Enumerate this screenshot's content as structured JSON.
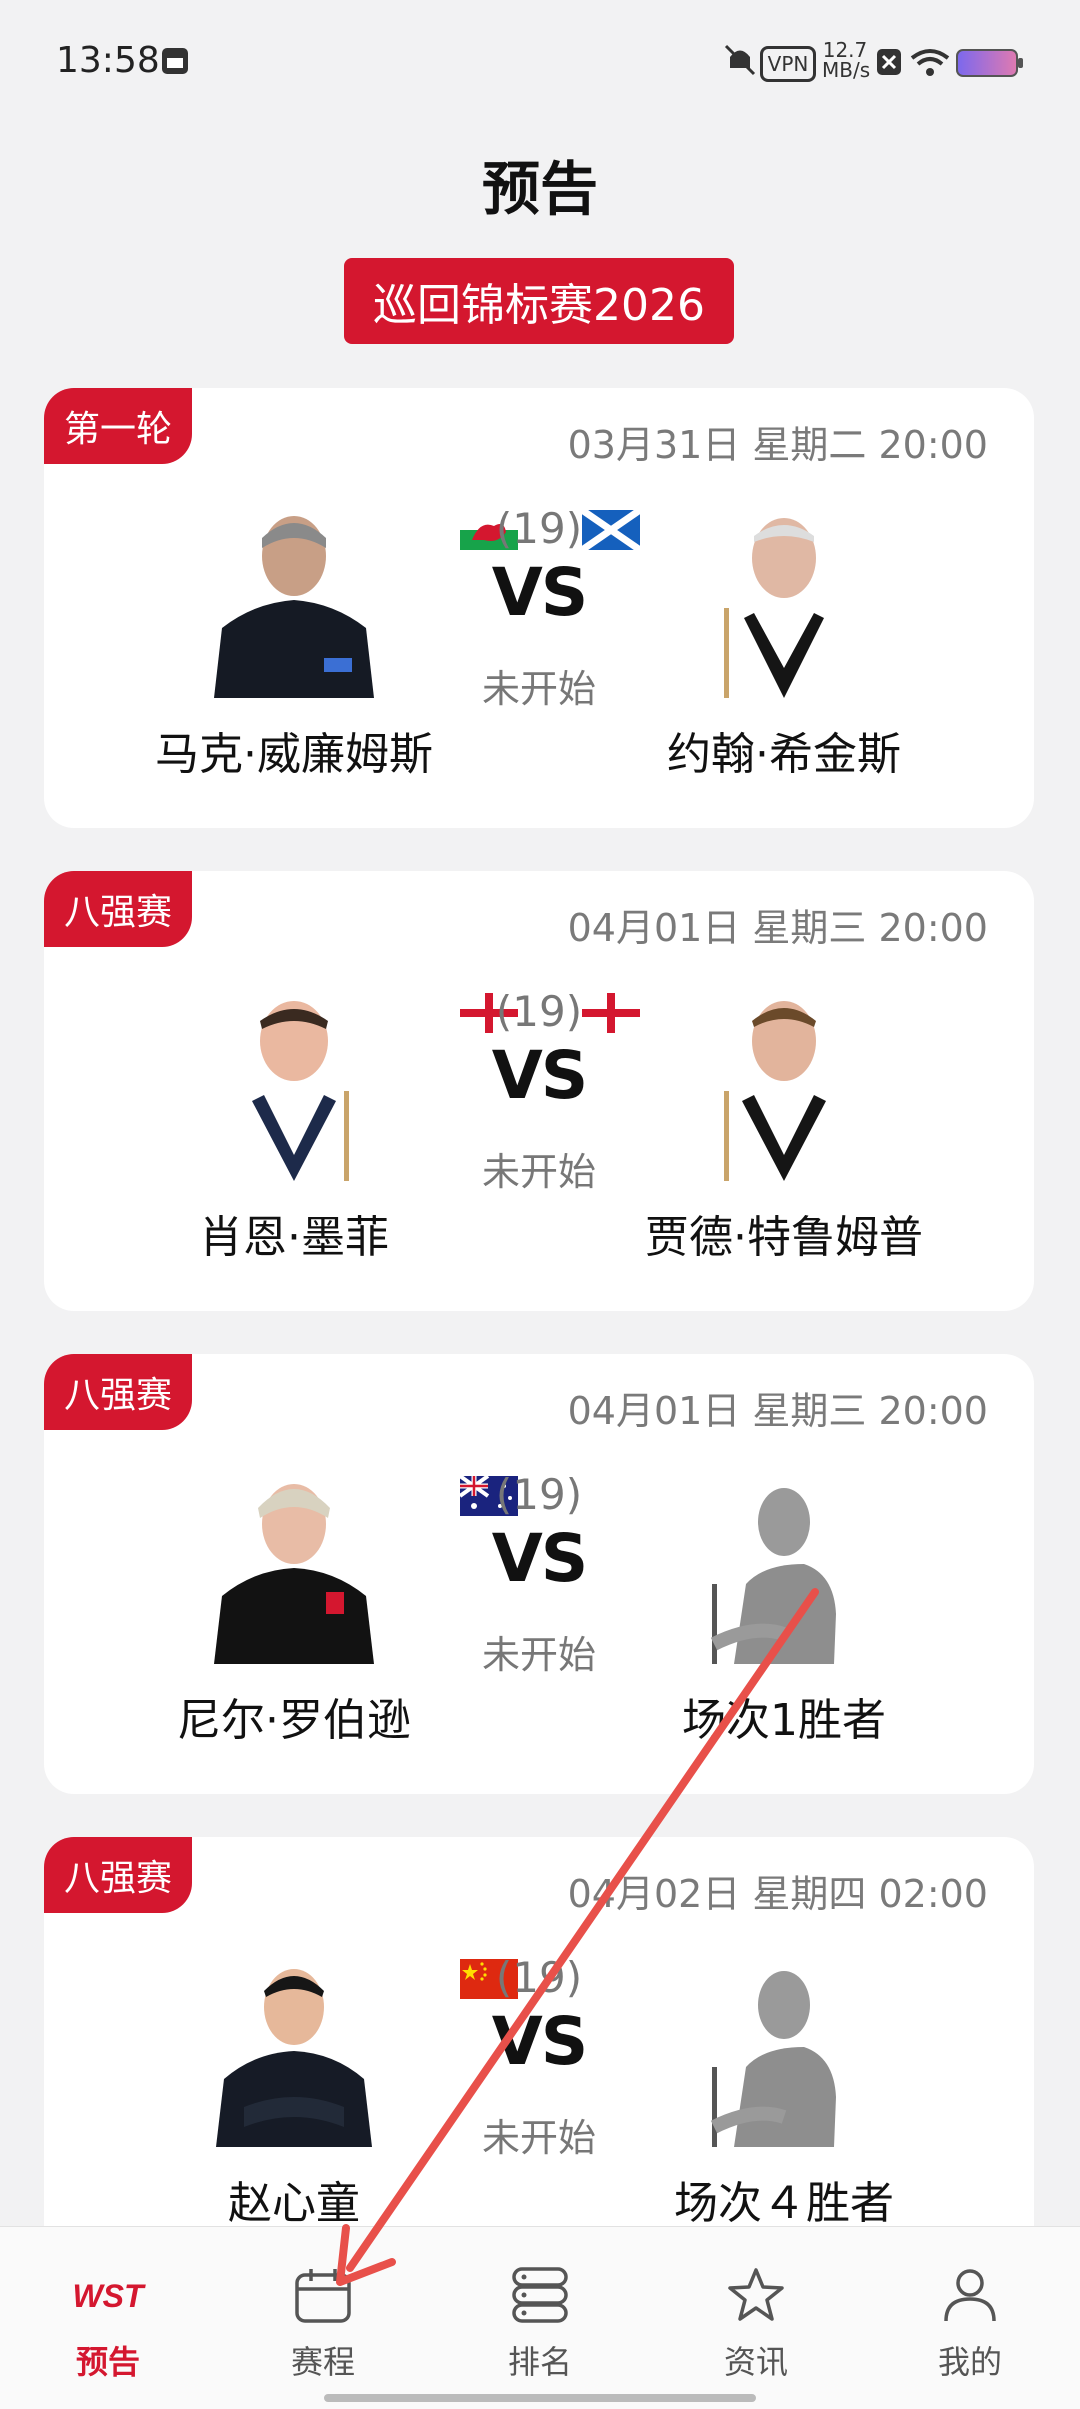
{
  "status_bar": {
    "time": "13:58",
    "vpn": "VPN",
    "net_speed_value": "12.7",
    "net_speed_unit": "MB/s"
  },
  "header": {
    "title": "预告",
    "tour_label": "巡回锦标赛2026"
  },
  "matches": [
    {
      "round": "第一轮",
      "datetime": "03月31日 星期二 20:00",
      "left_player": "马克·威廉姆斯",
      "right_player": "约翰·希金斯",
      "frames": "(19)",
      "vs": "VS",
      "status": "未开始",
      "left_flag": "wales-flag",
      "right_flag": "scotland-flag"
    },
    {
      "round": "八强赛",
      "datetime": "04月01日 星期三 20:00",
      "left_player": "肖恩·墨菲",
      "right_player": "贾德·特鲁姆普",
      "frames": "(19)",
      "vs": "VS",
      "status": "未开始",
      "left_flag": "england-flag",
      "right_flag": "england-flag"
    },
    {
      "round": "八强赛",
      "datetime": "04月01日 星期三 20:00",
      "left_player": "尼尔·罗伯逊",
      "right_player": "场次1胜者",
      "frames": "(19)",
      "vs": "VS",
      "status": "未开始",
      "left_flag": "australia-flag",
      "right_flag": ""
    },
    {
      "round": "八强赛",
      "datetime": "04月02日 星期四 02:00",
      "left_player": "赵心童",
      "right_player": "场次４胜者",
      "frames": "(19)",
      "vs": "VS",
      "status": "未开始",
      "left_flag": "china-flag",
      "right_flag": ""
    }
  ],
  "tabbar": {
    "logo_text": "WST",
    "items": [
      {
        "label": "预告",
        "icon": "wst-logo-icon",
        "active": true
      },
      {
        "label": "赛程",
        "icon": "calendar-icon",
        "active": false
      },
      {
        "label": "排名",
        "icon": "ranking-icon",
        "active": false
      },
      {
        "label": "资讯",
        "icon": "star-icon",
        "active": false
      },
      {
        "label": "我的",
        "icon": "profile-icon",
        "active": false
      }
    ]
  },
  "colors": {
    "accent": "#d4172f",
    "background": "#f2f2f3",
    "card": "#ffffff",
    "muted_text": "#777777",
    "annotation_arrow": "#e8504a"
  }
}
